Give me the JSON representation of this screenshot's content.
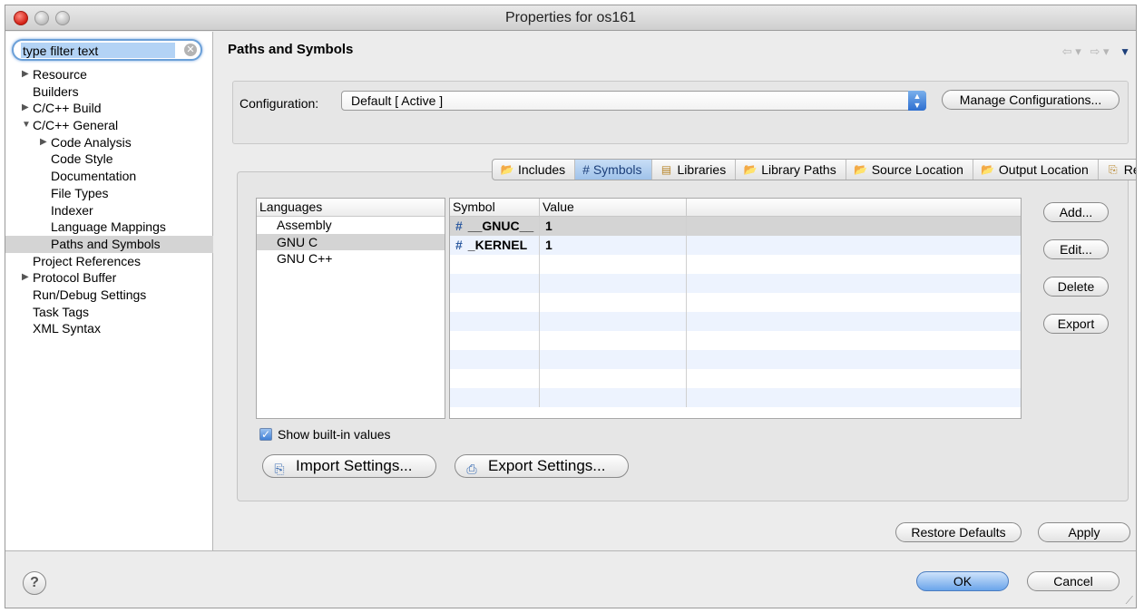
{
  "window": {
    "title": "Properties for os161"
  },
  "filter": {
    "value": "type filter text"
  },
  "tree": [
    {
      "label": "Resource",
      "depth": 0,
      "arrow": "▶"
    },
    {
      "label": "Builders",
      "depth": 0,
      "arrow": ""
    },
    {
      "label": "C/C++ Build",
      "depth": 0,
      "arrow": "▶"
    },
    {
      "label": "C/C++ General",
      "depth": 0,
      "arrow": "▼"
    },
    {
      "label": "Code Analysis",
      "depth": 1,
      "arrow": "▶"
    },
    {
      "label": "Code Style",
      "depth": 1,
      "arrow": ""
    },
    {
      "label": "Documentation",
      "depth": 1,
      "arrow": ""
    },
    {
      "label": "File Types",
      "depth": 1,
      "arrow": ""
    },
    {
      "label": "Indexer",
      "depth": 1,
      "arrow": ""
    },
    {
      "label": "Language Mappings",
      "depth": 1,
      "arrow": ""
    },
    {
      "label": "Paths and Symbols",
      "depth": 1,
      "arrow": "",
      "selected": true
    },
    {
      "label": "Project References",
      "depth": 0,
      "arrow": ""
    },
    {
      "label": "Protocol Buffer",
      "depth": 0,
      "arrow": "▶"
    },
    {
      "label": "Run/Debug Settings",
      "depth": 0,
      "arrow": ""
    },
    {
      "label": "Task Tags",
      "depth": 0,
      "arrow": ""
    },
    {
      "label": "XML Syntax",
      "depth": 0,
      "arrow": ""
    }
  ],
  "page": {
    "title": "Paths and Symbols"
  },
  "config": {
    "label": "Configuration:",
    "selected": "Default  [ Active ]",
    "manage_label": "Manage Configurations..."
  },
  "tabs": [
    {
      "label": "Includes",
      "icon": "includes-icon",
      "active": false
    },
    {
      "label": "# Symbols",
      "icon": "",
      "active": true
    },
    {
      "label": "Libraries",
      "icon": "libraries-icon",
      "active": false
    },
    {
      "label": "Library Paths",
      "icon": "library-paths-icon",
      "active": false
    },
    {
      "label": "Source Location",
      "icon": "source-location-icon",
      "active": false
    },
    {
      "label": "Output Location",
      "icon": "output-location-icon",
      "active": false
    },
    {
      "label": "References",
      "icon": "references-icon",
      "active": false
    }
  ],
  "languages": {
    "header": "Languages",
    "items": [
      "Assembly",
      "GNU C",
      "GNU C++"
    ],
    "selected_index": 1
  },
  "symbols": {
    "columns": [
      "Symbol",
      "Value",
      ""
    ],
    "rows": [
      {
        "symbol": "__GNUC__",
        "value": "1"
      },
      {
        "symbol": "_KERNEL",
        "value": "1"
      }
    ],
    "empty_rows": 8
  },
  "side_buttons": {
    "add": "Add...",
    "edit": "Edit...",
    "delete": "Delete",
    "export": "Export"
  },
  "show_builtin": {
    "label": "Show built-in values",
    "checked": true
  },
  "import_settings": "Import Settings...",
  "export_settings": "Export Settings...",
  "restore_defaults": "Restore Defaults",
  "apply": "Apply",
  "ok": "OK",
  "cancel": "Cancel",
  "help_glyph": "?"
}
